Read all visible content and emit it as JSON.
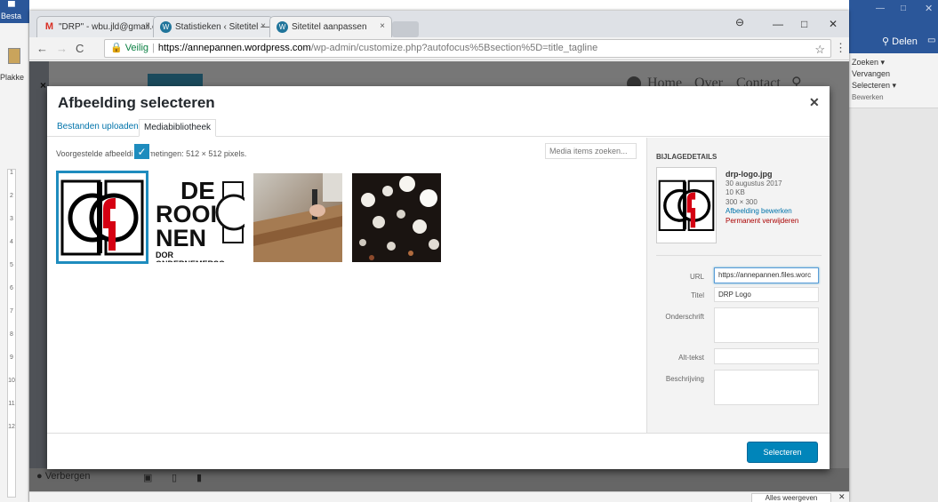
{
  "word": {
    "left_labels": [
      "Besta",
      "Plakke"
    ],
    "delen": "Delen",
    "editing": {
      "find": "Zoeken",
      "replace": "Vervangen",
      "select": "Selecteren",
      "group": "Bewerken"
    },
    "ruler": [
      "1",
      "2",
      "3",
      "4",
      "5",
      "6",
      "7",
      "8",
      "9",
      "10",
      "11",
      "12"
    ]
  },
  "browser": {
    "tabs": [
      {
        "label": "\"DRP\" - wbu.jld@gmail.c",
        "icon": "M"
      },
      {
        "label": "Statistieken ‹ Sitetitel —",
        "icon": "W"
      },
      {
        "label": "Sitetitel aanpassen",
        "icon": "W"
      }
    ],
    "address": {
      "secure": "Veilig",
      "host": "https://annepannen.wordpress.com",
      "path": "/wp-admin/customize.php?autofocus%5Bsection%5D=title_tagline"
    }
  },
  "page": {
    "nav": [
      "Home",
      "Over",
      "Contact"
    ],
    "hide_label": "Verbergen"
  },
  "modal": {
    "title": "Afbeelding selecteren",
    "tabs": [
      "Bestanden uploaden",
      "Mediabibliotheek"
    ],
    "suggested": "Voorgestelde afbeeldingafmetingen: 512 × 512 pixels.",
    "search_placeholder": "Media items zoeken...",
    "thumb2_lines": [
      "DE",
      "ROOI",
      "NEN",
      "DOR ONDERNEMERSO"
    ],
    "details": {
      "heading": "BIJLAGEDETAILS",
      "filename": "drp-logo.jpg",
      "date": "30 augustus 2017",
      "size": "10 KB",
      "dimensions": "300 × 300",
      "edit": "Afbeelding bewerken",
      "delete": "Permanent verwijderen"
    },
    "fields": {
      "url_label": "URL",
      "url_value": "https://annepannen.files.worc",
      "title_label": "Titel",
      "title_value": "DRP Logo",
      "caption_label": "Onderschrift",
      "alt_label": "Alt-tekst",
      "desc_label": "Beschrijving"
    },
    "select_button": "Selecteren"
  },
  "downloads": {
    "all": "Alles weergeven"
  },
  "colors": {
    "wp_blue": "#0085ba",
    "word_blue": "#2b579a",
    "select_border": "#1e8cbe",
    "danger": "#a00"
  }
}
